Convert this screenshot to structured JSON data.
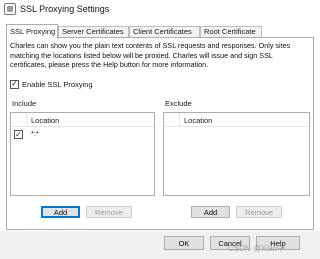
{
  "window": {
    "title": "SSL Proxying Settings"
  },
  "tabs": [
    {
      "label": "SSL Proxying",
      "active": true
    },
    {
      "label": "Server Certificates"
    },
    {
      "label": "Client Certificates"
    },
    {
      "label": "Root Certificate"
    }
  ],
  "description": "Charles can show you the plain text contents of SSL requests and responses. Only sites matching the locations listed below will be proxied. Charles will issue and sign SSL certificates, please press the Help button for more information.",
  "enable_ssl": {
    "label": "Enable SSL Proxying",
    "checked": true
  },
  "include": {
    "label": "Include",
    "column": "Location",
    "rows": [
      {
        "checked": true,
        "location": "*:*"
      }
    ],
    "add_label": "Add",
    "remove_label": "Remove"
  },
  "exclude": {
    "label": "Exclude",
    "column": "Location",
    "rows": [],
    "add_label": "Add",
    "remove_label": "Remove"
  },
  "footer": {
    "ok_label": "OK",
    "cancel_label": "Cancel",
    "help_label": "Help"
  },
  "watermark": "CSDN @Xiao中",
  "colors": {
    "focus_border": "#0078d7",
    "button_bg": "#e1e1e1",
    "footer_bg": "#f0f0f0"
  }
}
